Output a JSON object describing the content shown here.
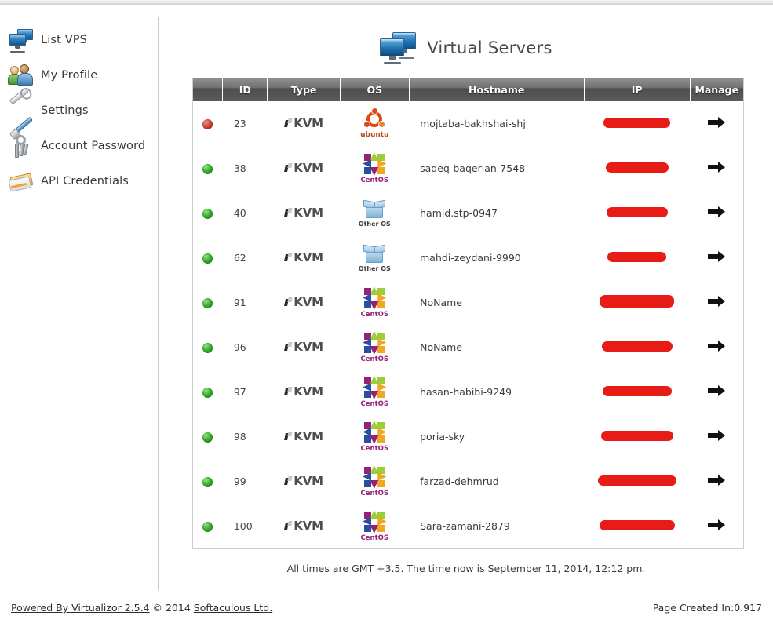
{
  "sidebar": {
    "items": [
      {
        "label": "List VPS",
        "icon": "monitors-icon"
      },
      {
        "label": "My Profile",
        "icon": "people-icon"
      },
      {
        "label": "Settings",
        "icon": "tools-icon"
      },
      {
        "label": "Account Password",
        "icon": "keys-icon"
      },
      {
        "label": "API Credentials",
        "icon": "card-icon"
      }
    ]
  },
  "header": {
    "title": "Virtual Servers",
    "icon": "monitors-icon"
  },
  "table": {
    "columns": [
      "",
      "ID",
      "Type",
      "OS",
      "Hostname",
      "IP",
      "Manage"
    ],
    "rows": [
      {
        "status": "off",
        "id": "23",
        "type": "KVM",
        "os": "ubuntu",
        "os_label": "ubuntu",
        "hostname": "mojtaba-bakhshai-shj",
        "ip_redacted": true,
        "manage": "arrow-right-icon"
      },
      {
        "status": "on",
        "id": "38",
        "type": "KVM",
        "os": "centos",
        "os_label": "CentOS",
        "hostname": "sadeq-baqerian-7548",
        "ip_redacted": true,
        "manage": "arrow-right-icon"
      },
      {
        "status": "on",
        "id": "40",
        "type": "KVM",
        "os": "other",
        "os_label": "Other OS",
        "hostname": "hamid.stp-0947",
        "ip_redacted": true,
        "manage": "arrow-right-icon"
      },
      {
        "status": "on",
        "id": "62",
        "type": "KVM",
        "os": "other",
        "os_label": "Other OS",
        "hostname": "mahdi-zeydani-9990",
        "ip_redacted": true,
        "manage": "arrow-right-icon"
      },
      {
        "status": "on",
        "id": "91",
        "type": "KVM",
        "os": "centos",
        "os_label": "CentOS",
        "hostname": "NoName",
        "ip_redacted": true,
        "manage": "arrow-right-icon"
      },
      {
        "status": "on",
        "id": "96",
        "type": "KVM",
        "os": "centos",
        "os_label": "CentOS",
        "hostname": "NoName",
        "ip_redacted": true,
        "manage": "arrow-right-icon"
      },
      {
        "status": "on",
        "id": "97",
        "type": "KVM",
        "os": "centos",
        "os_label": "CentOS",
        "hostname": "hasan-habibi-9249",
        "ip_redacted": true,
        "manage": "arrow-right-icon"
      },
      {
        "status": "on",
        "id": "98",
        "type": "KVM",
        "os": "centos",
        "os_label": "CentOS",
        "hostname": "poria-sky",
        "ip_redacted": true,
        "manage": "arrow-right-icon"
      },
      {
        "status": "on",
        "id": "99",
        "type": "KVM",
        "os": "centos",
        "os_label": "CentOS",
        "hostname": "farzad-dehmrud",
        "ip_redacted": true,
        "manage": "arrow-right-icon"
      },
      {
        "status": "on",
        "id": "100",
        "type": "KVM",
        "os": "centos",
        "os_label": "CentOS",
        "hostname": "Sara-zamani-2879",
        "ip_redacted": true,
        "manage": "arrow-right-icon"
      }
    ]
  },
  "times_note": "All times are GMT +3.5. The time now is September 11, 2014, 12:12 pm.",
  "footer": {
    "powered_by": "Powered By Virtualizor 2.5.4",
    "copyright": "© 2014",
    "company": "Softaculous Ltd.",
    "page_created": "Page Created In:0.917"
  },
  "colors": {
    "status_on": "#3cb031",
    "status_off": "#d0443a",
    "redaction": "#e81c16",
    "header_bg": "#5a5a5a"
  }
}
